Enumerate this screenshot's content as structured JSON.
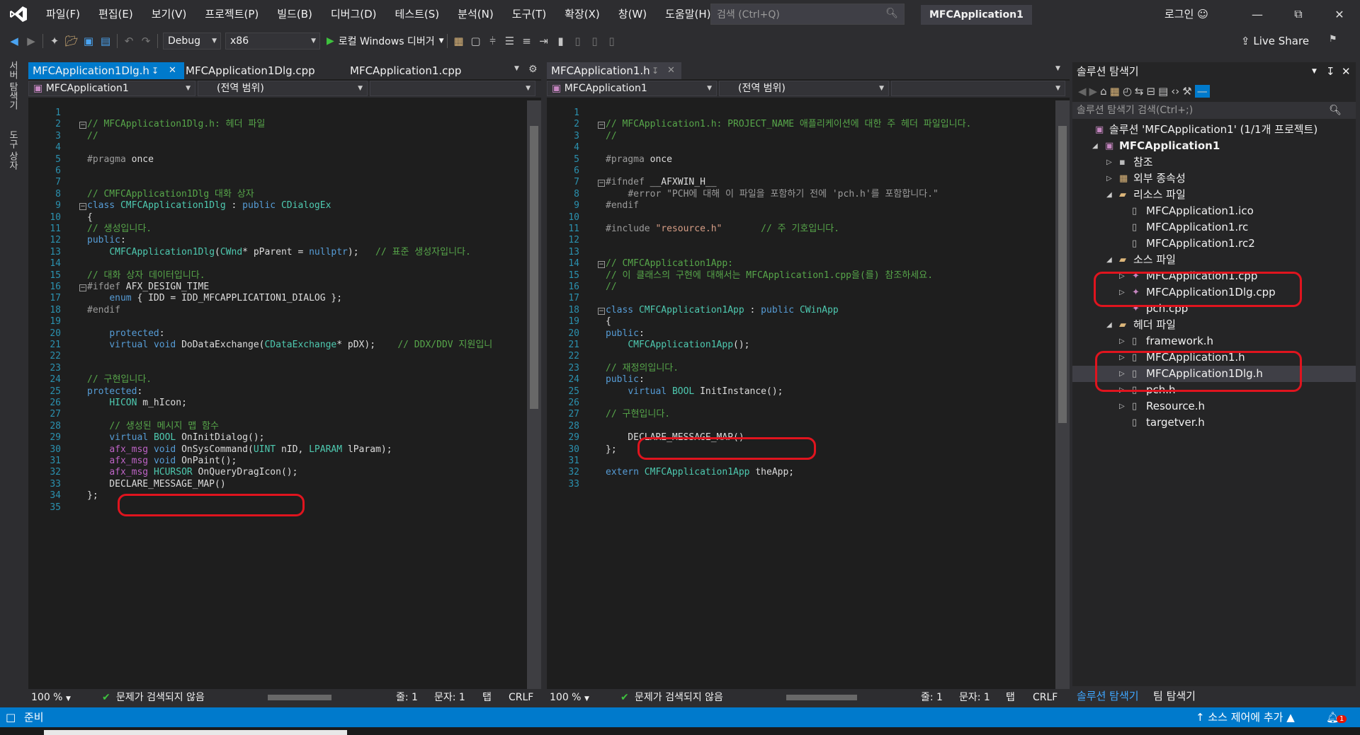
{
  "menu": {
    "items": [
      "파일(F)",
      "편집(E)",
      "보기(V)",
      "프로젝트(P)",
      "빌드(B)",
      "디버그(D)",
      "테스트(S)",
      "분석(N)",
      "도구(T)",
      "확장(X)",
      "창(W)",
      "도움말(H)"
    ],
    "search_placeholder": "검색 (Ctrl+Q)",
    "solution_name": "MFCApplication1",
    "login": "로그인"
  },
  "toolbar": {
    "config": "Debug",
    "platform": "x86",
    "run_label": "로컬 Windows 디버거",
    "live_share": "Live Share"
  },
  "left_strip": {
    "server_explorer": "서버 탐색기",
    "toolbox": "도구 상자"
  },
  "left_pane": {
    "tabs": [
      "MFCApplication1Dlg.h",
      "MFCApplication1Dlg.cpp",
      "MFCApplication1.cpp"
    ],
    "nav_project": "MFCApplication1",
    "nav_scope": "(전역 범위)",
    "lines": [
      "",
      "// MFCApplication1Dlg.h: 헤더 파일",
      "//",
      "",
      "#pragma once",
      "",
      "",
      "// CMFCApplication1Dlg 대화 상자",
      "class CMFCApplication1Dlg : public CDialogEx",
      "{",
      "// 생성입니다.",
      "public:",
      "    CMFCApplication1Dlg(CWnd* pParent = nullptr);   // 표준 생성자입니다.",
      "",
      "// 대화 상자 데이터입니다.",
      "#ifdef AFX_DESIGN_TIME",
      "    enum { IDD = IDD_MFCAPPLICATION1_DIALOG };",
      "#endif",
      "",
      "    protected:",
      "    virtual void DoDataExchange(CDataExchange* pDX);    // DDX/DDV 지원입니",
      "",
      "",
      "// 구현입니다.",
      "protected:",
      "    HICON m_hIcon;",
      "",
      "    // 생성된 메시지 맵 함수",
      "    virtual BOOL OnInitDialog();",
      "    afx_msg void OnSysCommand(UINT nID, LPARAM lParam);",
      "    afx_msg void OnPaint();",
      "    afx_msg HCURSOR OnQueryDragIcon();",
      "    DECLARE_MESSAGE_MAP()",
      "};",
      ""
    ],
    "zoom": "100 %",
    "issues": "문제가 검색되지 않음",
    "line_pos": "줄: 1",
    "col_pos": "문자: 1",
    "tab_mode": "탭",
    "eol": "CRLF"
  },
  "right_pane": {
    "tabs": [
      "MFCApplication1.h"
    ],
    "nav_project": "MFCApplication1",
    "nav_scope": "(전역 범위)",
    "lines": [
      "",
      "// MFCApplication1.h: PROJECT_NAME 애플리케이션에 대한 주 헤더 파일입니다.",
      "//",
      "",
      "#pragma once",
      "",
      "#ifndef __AFXWIN_H__",
      "    #error \"PCH에 대해 이 파일을 포함하기 전에 'pch.h'를 포함합니다.\"",
      "#endif",
      "",
      "#include \"resource.h\"       // 주 기호입니다.",
      "",
      "",
      "// CMFCApplication1App:",
      "// 이 클래스의 구현에 대해서는 MFCApplication1.cpp을(를) 참조하세요.",
      "//",
      "",
      "class CMFCApplication1App : public CWinApp",
      "{",
      "public:",
      "    CMFCApplication1App();",
      "",
      "// 재정의입니다.",
      "public:",
      "    virtual BOOL InitInstance();",
      "",
      "// 구현입니다.",
      "",
      "    DECLARE_MESSAGE_MAP()",
      "};",
      "",
      "extern CMFCApplication1App theApp;",
      ""
    ],
    "zoom": "100 %",
    "issues": "문제가 검색되지 않음",
    "line_pos": "줄: 1",
    "col_pos": "문자: 1",
    "tab_mode": "탭",
    "eol": "CRLF"
  },
  "solution_explorer": {
    "title": "솔루션 탐색기",
    "search_placeholder": "솔루션 탐색기 검색(Ctrl+;)",
    "tree": [
      {
        "label": "솔루션 'MFCApplication1' (1/1개 프로젝트)",
        "icon": "solution-icon"
      },
      {
        "label": "MFCApplication1",
        "icon": "project-icon"
      },
      {
        "label": "참조",
        "icon": "references-icon"
      },
      {
        "label": "외부 종속성",
        "icon": "external-deps-icon"
      },
      {
        "label": "리소스 파일",
        "icon": "folder-icon"
      },
      {
        "label": "MFCApplication1.ico",
        "icon": "file-icon"
      },
      {
        "label": "MFCApplication1.rc",
        "icon": "file-icon"
      },
      {
        "label": "MFCApplication1.rc2",
        "icon": "file-icon"
      },
      {
        "label": "소스 파일",
        "icon": "folder-icon"
      },
      {
        "label": "MFCApplication1.cpp",
        "icon": "cpp-file-icon"
      },
      {
        "label": "MFCApplication1Dlg.cpp",
        "icon": "cpp-file-icon"
      },
      {
        "label": "pch.cpp",
        "icon": "cpp-file-icon"
      },
      {
        "label": "헤더 파일",
        "icon": "folder-icon"
      },
      {
        "label": "framework.h",
        "icon": "header-file-icon"
      },
      {
        "label": "MFCApplication1.h",
        "icon": "header-file-icon"
      },
      {
        "label": "MFCApplication1Dlg.h",
        "icon": "header-file-icon"
      },
      {
        "label": "pch.h",
        "icon": "header-file-icon"
      },
      {
        "label": "Resource.h",
        "icon": "header-file-icon"
      },
      {
        "label": "targetver.h",
        "icon": "header-file-icon"
      }
    ],
    "bottom_tabs": [
      "솔루션 탐색기",
      "팀 탐색기"
    ]
  },
  "statusbar": {
    "ready": "준비",
    "source_control": "소스 제어에 추가",
    "notifications": "1"
  },
  "colors": {
    "accent": "#007acc",
    "highlight": "#e0141e"
  }
}
